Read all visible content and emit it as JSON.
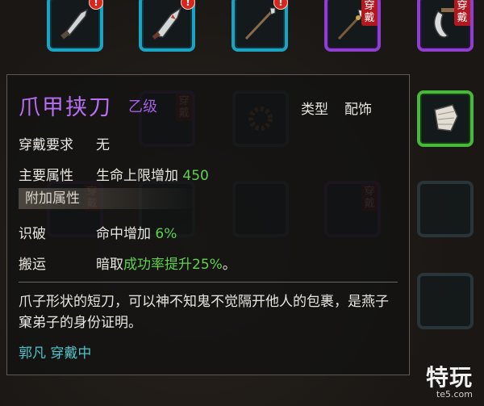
{
  "item": {
    "name": "爪甲挟刀",
    "grade": "乙级",
    "type_label": "类型",
    "type_value": "配饰",
    "requirement_label": "穿戴要求",
    "requirement_value": "无",
    "main_attr_label": "主要属性",
    "main_attr_text": "生命上限增加",
    "main_attr_value": "450",
    "extra_attr_header": "附加属性",
    "extra_attrs": [
      {
        "label": "识破",
        "text": "命中增加",
        "value": "6%"
      },
      {
        "label": "搬运",
        "text_prefix": "暗取",
        "text_highlight": "成功率提升25%",
        "text_suffix": "。"
      }
    ],
    "description": "爪子形状的短刀，可以神不知鬼不觉隔开他人的包裹，是燕子窠弟子的身份证明。",
    "wearer": "郭凡 穿戴中"
  },
  "slots": {
    "wear_tag": "穿戴",
    "alert_mark": "!"
  },
  "colors": {
    "title": "#b86ef0",
    "highlight_green": "#5fd14b",
    "wearer_cyan": "#4fc3c8",
    "blue_rarity": "#1ba3c2",
    "purple_rarity": "#8f3fd0",
    "green_rarity": "#48b83a"
  },
  "watermark": {
    "main": "特玩",
    "sub": "te5.com"
  }
}
